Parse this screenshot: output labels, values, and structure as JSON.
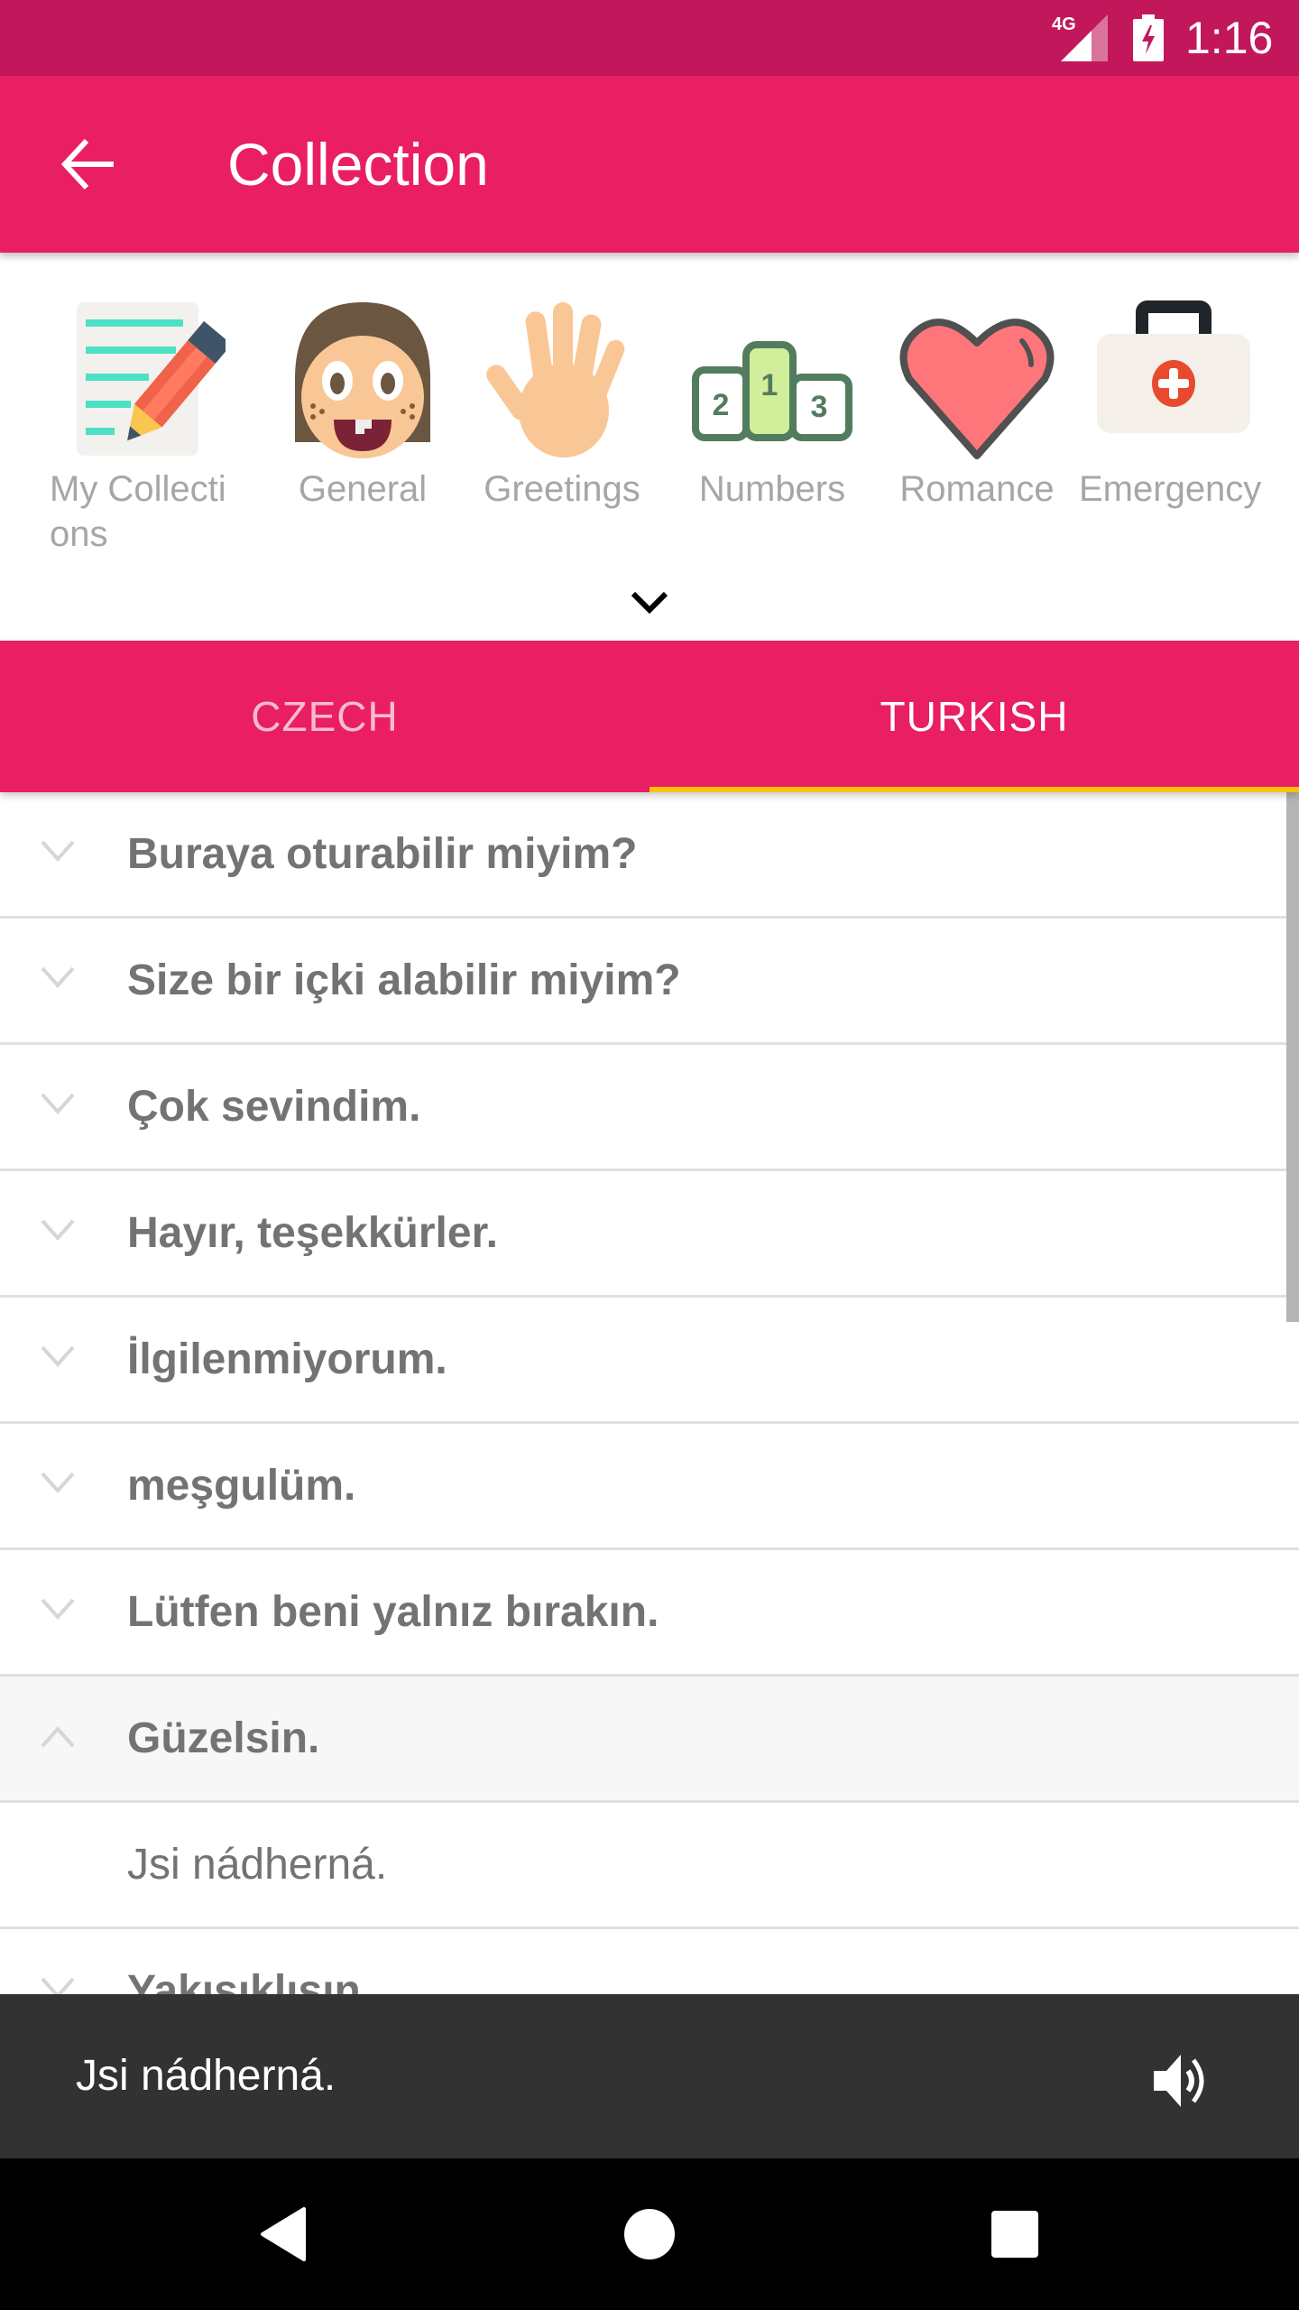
{
  "status_bar": {
    "network": "4G",
    "time": "1:16"
  },
  "app_bar": {
    "title": "Collection",
    "back_icon": "arrow-back-icon"
  },
  "categories": [
    {
      "label": "My Collections",
      "icon": "notepad-pencil-icon"
    },
    {
      "label": "General",
      "icon": "face-icon"
    },
    {
      "label": "Greetings",
      "icon": "waving-hand-icon"
    },
    {
      "label": "Numbers",
      "icon": "podium-icon"
    },
    {
      "label": "Romance",
      "icon": "heart-icon"
    },
    {
      "label": "Emergency",
      "icon": "first-aid-kit-icon"
    }
  ],
  "expand_icon": "chevron-down-icon",
  "tabs": [
    {
      "label": "CZECH",
      "active": false
    },
    {
      "label": "TURKISH",
      "active": true
    }
  ],
  "colors": {
    "status_bar": "#C2185B",
    "primary": "#E91E63",
    "tab_indicator": "#FFC107",
    "snackbar": "#323232"
  },
  "phrases": [
    {
      "text": "Buraya oturabilir miyim?",
      "expanded": false
    },
    {
      "text": "Size bir içki alabilir miyim?",
      "expanded": false
    },
    {
      "text": "Çok sevindim.",
      "expanded": false
    },
    {
      "text": "Hayır, teşekkürler.",
      "expanded": false
    },
    {
      "text": "İlgilenmiyorum.",
      "expanded": false
    },
    {
      "text": "meşgulüm.",
      "expanded": false
    },
    {
      "text": "Lütfen beni yalnız bırakın.",
      "expanded": false
    },
    {
      "text": "Güzelsin.",
      "expanded": true,
      "translation": "Jsi nádherná."
    },
    {
      "text": "Yakışıklısın.",
      "expanded": false
    }
  ],
  "snackbar": {
    "text": "Jsi nádherná.",
    "action_icon": "speaker-icon"
  },
  "nav_bar": {
    "back": "nav-back-icon",
    "home": "nav-home-icon",
    "recents": "nav-recents-icon"
  }
}
